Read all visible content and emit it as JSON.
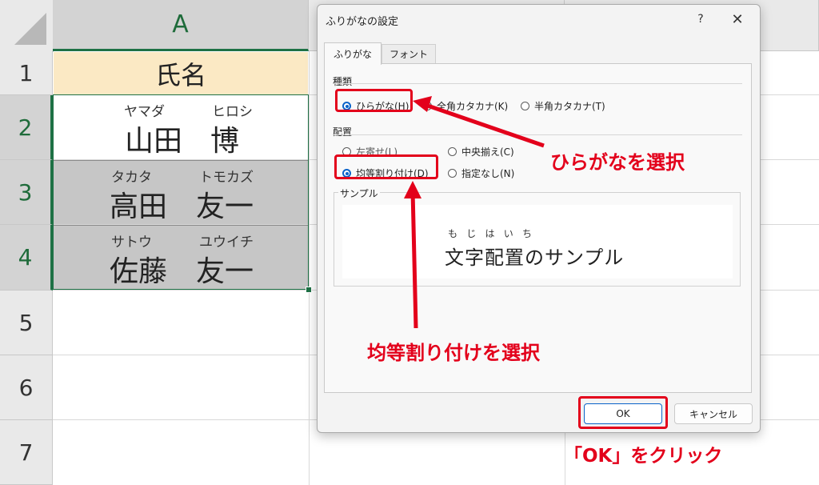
{
  "sheet": {
    "column_header": "A",
    "row_numbers": [
      "1",
      "2",
      "3",
      "4",
      "5",
      "6",
      "7"
    ],
    "header_cell": "氏名",
    "rows": [
      {
        "ruby_last": "ヤマダ",
        "ruby_first": "ヒロシ",
        "last": "山田",
        "first": "博"
      },
      {
        "ruby_last": "タカタ",
        "ruby_first": "トモカズ",
        "last": "高田",
        "first": "友一"
      },
      {
        "ruby_last": "サトウ",
        "ruby_first": "ユウイチ",
        "last": "佐藤",
        "first": "友一"
      }
    ],
    "colors": {
      "header_fill": "#fbe9c4",
      "selected_fill": "#c6c6c6",
      "selection_border": "#1e7145"
    }
  },
  "dialog": {
    "title": "ふりがなの設定",
    "help": "?",
    "close": "✕",
    "tabs": [
      {
        "label": "ふりがな",
        "active": true
      },
      {
        "label": "フォント",
        "active": false
      }
    ],
    "type_group": {
      "label": "種類",
      "options": [
        {
          "label": "ひらがな(H)",
          "checked": true
        },
        {
          "label": "全角カタカナ(K)",
          "checked": false
        },
        {
          "label": "半角カタカナ(T)",
          "checked": false
        }
      ]
    },
    "align_group": {
      "label": "配置",
      "options": [
        {
          "label": "左寄せ(L)",
          "checked": false
        },
        {
          "label": "中央揃え(C)",
          "checked": false
        },
        {
          "label": "均等割り付け(D)",
          "checked": true
        },
        {
          "label": "指定なし(N)",
          "checked": false
        }
      ]
    },
    "sample": {
      "label": "サンプル",
      "ruby": [
        "も",
        "じ",
        "は",
        "い",
        "ち"
      ],
      "text": "文字配置のサンプル"
    },
    "ok_label": "OK",
    "cancel_label": "キャンセル"
  },
  "annotations": {
    "hiragana_callout": "ひらがなを選択",
    "justify_callout": "均等割り付けを選択",
    "ok_callout": "「OK」をクリック",
    "color": "#e3001b"
  }
}
